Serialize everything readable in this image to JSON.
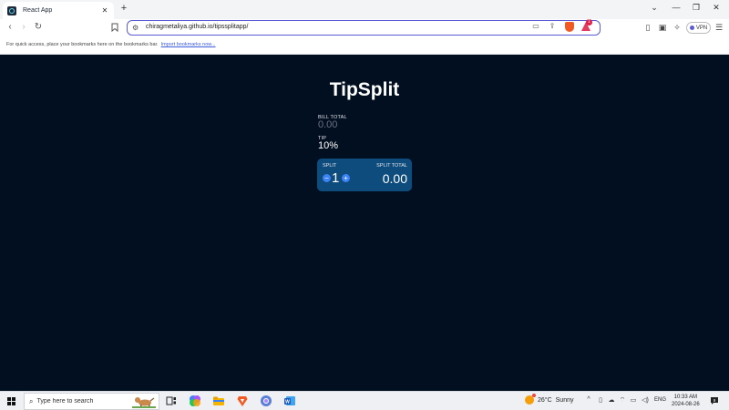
{
  "browser": {
    "tab_title": "React App",
    "tab_close": "✕",
    "new_tab": "+",
    "url": "chiragmetaliya.github.io/tipssplitapp/",
    "vpn_label": "VPN",
    "rewards_count": "1",
    "bookmarks_message": "For quick access, place your bookmarks here on the bookmarks bar.",
    "bookmarks_link": "Import bookmarks now...",
    "accent_color": "#5b5bd6"
  },
  "app": {
    "title": "TipSplit",
    "bill_total_label": "BILL TOTAL",
    "bill_total_value": "0.00",
    "tip_label": "TIP",
    "tip_value": "10%",
    "split_label": "SPLIT",
    "split_decrement": "−",
    "split_count": "1",
    "split_increment": "+",
    "split_total_label": "SPLIT TOTAL",
    "split_total_value": "0.00",
    "background_color": "#010f20",
    "card_color": "#0e4c7e"
  },
  "taskbar": {
    "search_placeholder": "Type here to search",
    "weather_temp": "26°C",
    "weather_condition": "Sunny",
    "language": "ENG",
    "time": "10:33 AM",
    "date": "2024-08-26",
    "notification_count": "9",
    "apps": [
      "task-view-icon",
      "copilot-icon",
      "file-explorer-icon",
      "brave-icon",
      "chrome-icon",
      "word-icon"
    ]
  }
}
